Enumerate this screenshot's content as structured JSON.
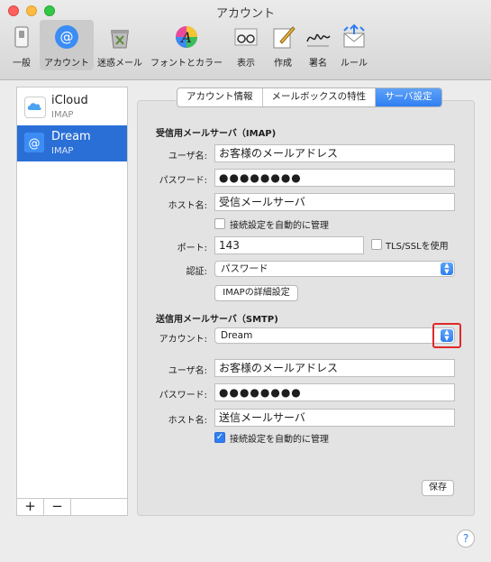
{
  "window": {
    "title": "アカウント"
  },
  "toolbar": [
    {
      "label": "一般",
      "icon": "switch-icon"
    },
    {
      "label": "アカウント",
      "icon": "at-sign-icon",
      "selected": true
    },
    {
      "label": "迷惑メール",
      "icon": "junk-mail-icon"
    },
    {
      "label": "フォントとカラー",
      "icon": "color-font-icon"
    },
    {
      "label": "表示",
      "icon": "glasses-icon"
    },
    {
      "label": "作成",
      "icon": "compose-icon"
    },
    {
      "label": "署名",
      "icon": "signature-icon"
    },
    {
      "label": "ルール",
      "icon": "rules-icon"
    }
  ],
  "sidebar": {
    "accounts": [
      {
        "name": "iCloud",
        "type": "IMAP",
        "icon": "icloud-icon"
      },
      {
        "name": "Dream",
        "type": "IMAP",
        "icon": "at-sign-icon",
        "selected": true
      }
    ],
    "add_label": "+",
    "remove_label": "−"
  },
  "tabs": [
    {
      "label": "アカウント情報"
    },
    {
      "label": "メールボックスの特性"
    },
    {
      "label": "サーバ設定",
      "selected": true
    }
  ],
  "incoming": {
    "heading": "受信用メールサーバ（IMAP)",
    "username_label": "ユーザ名:",
    "username": "お客様のメールアドレス",
    "password_label": "パスワード:",
    "password": "●●●●●●●●",
    "host_label": "ホスト名:",
    "host": "受信メールサーバ",
    "auto_manage_label": "接続設定を自動的に管理",
    "auto_manage": false,
    "port_label": "ポート:",
    "port": "143",
    "tls_label": "TLS/SSLを使用",
    "tls": false,
    "auth_label": "認証:",
    "auth": "パスワード",
    "advanced_button": "IMAPの詳細設定"
  },
  "outgoing": {
    "heading": "送信用メールサーバ（SMTP)",
    "account_label": "アカウント:",
    "account": "Dream",
    "username_label": "ユーザ名:",
    "username": "お客様のメールアドレス",
    "password_label": "パスワード:",
    "password": "●●●●●●●●",
    "host_label": "ホスト名:",
    "host": "送信メールサーバ",
    "auto_manage_label": "接続設定を自動的に管理",
    "auto_manage": true
  },
  "save_button": "保存",
  "help_label": "?",
  "colors": {
    "accent": "#2f7ef2",
    "selection": "#2a6fd6",
    "highlight": "#e0292a"
  }
}
